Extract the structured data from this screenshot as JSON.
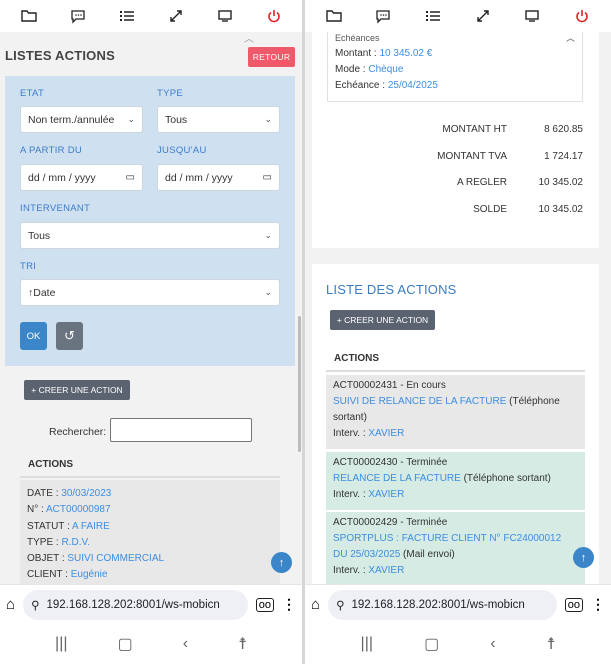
{
  "left": {
    "title": "LISTES ACTIONS",
    "retour_label": "RETOUR",
    "filters": {
      "etat_label": "ETAT",
      "etat_value": "Non term./annulée",
      "type_label": "TYPE",
      "type_value": "Tous",
      "from_label": "A PARTIR DU",
      "from_value": "dd / mm / yyyy",
      "to_label": "JUSQU'AU",
      "to_value": "dd / mm / yyyy",
      "intervenant_label": "INTERVENANT",
      "intervenant_value": "Tous",
      "tri_label": "TRI",
      "tri_value": "↑Date",
      "ok_label": "OK"
    },
    "creer_label": "+ CREER UNE ACTION",
    "search_label": "Rechercher:",
    "actions_header": "ACTIONS",
    "card": {
      "date_k": "DATE :",
      "date_v": "30/03/2023",
      "num_k": "N° :",
      "num_v": "ACT00000987",
      "statut_k": "STATUT :",
      "statut_v": "A FAIRE",
      "type_k": "TYPE :",
      "type_v": "R.D.V.",
      "objet_k": "OBJET :",
      "objet_v": "SUIVI COMMERCIAL",
      "client_k": "CLIENT :",
      "client_v": "Eugénie"
    },
    "url": "192.168.128.202:8001/ws-mobicn"
  },
  "right": {
    "echeances_label": "Echéances",
    "montant_k": "Montant :",
    "montant_v": "10 345.02 €",
    "mode_k": "Mode :",
    "mode_v": "Chèque",
    "echeance_k": "Echéance :",
    "echeance_v": "25/04/2025",
    "totals": [
      {
        "k": "MONTANT HT",
        "v": "8 620.85"
      },
      {
        "k": "MONTANT TVA",
        "v": "1 724.17"
      },
      {
        "k": "A REGLER",
        "v": "10 345.02"
      },
      {
        "k": "SOLDE",
        "v": "10 345.02"
      }
    ],
    "list_title": "LISTE DES ACTIONS",
    "creer_label": "+ CREER UNE ACTION",
    "actions_header": "ACTIONS",
    "cards": [
      {
        "head": "ACT00002431 - En cours",
        "link": "SUIVI DE RELANCE DE LA FACTURE",
        "rest": " (Téléphone sortant)",
        "interv_k": "Interv. :",
        "interv_v": "XAVIER",
        "bg": "#e8e8e8"
      },
      {
        "head": "ACT00002430 - Terminée",
        "link": "RELANCE DE LA FACTURE",
        "rest": " (Téléphone sortant)",
        "interv_k": "Interv. :",
        "interv_v": "XAVIER",
        "bg": "#d5ebe3"
      },
      {
        "head": "ACT00002429 - Terminée",
        "link": "SPORTPLUS : FACTURE CLIENT N° FC24000012 DU 25/03/2025",
        "rest": " (Mail envoi)",
        "interv_k": "Interv. :",
        "interv_v": "XAVIER",
        "bg": "#d5ebe3"
      }
    ],
    "url": "192.168.128.202:8001/ws-mobicn"
  },
  "colors": {
    "accent": "#3a86c8",
    "retour": "#ee5a6a",
    "link": "#3d8ee0",
    "done_bg": "#d5ebe3"
  }
}
